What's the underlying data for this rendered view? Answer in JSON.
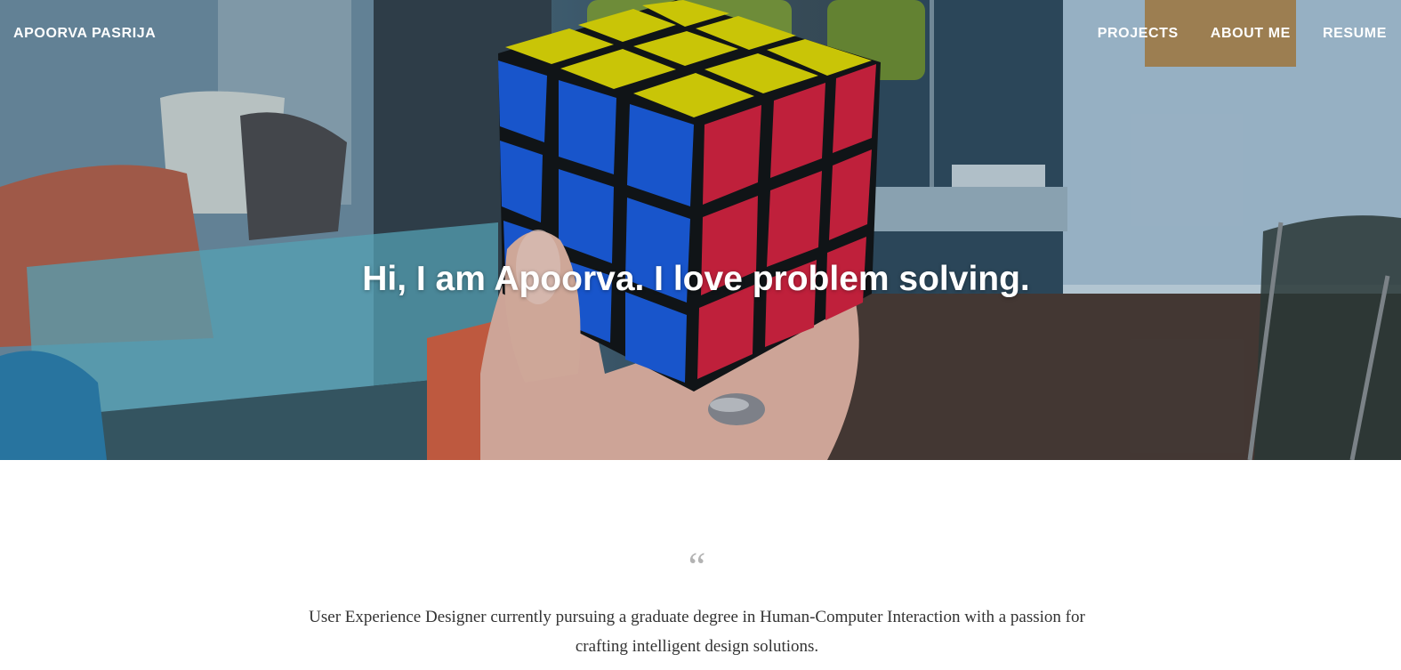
{
  "header": {
    "brand": "APOORVA PASRIJA",
    "nav": [
      "PROJECTS",
      "ABOUT ME",
      "RESUME"
    ]
  },
  "hero": {
    "headline": "Hi, I am Apoorva. I love problem solving.",
    "image": "rubiks-cube-in-hand"
  },
  "intro": {
    "quote_mark": "“",
    "text": "User Experience Designer currently pursuing a graduate degree in Human-Computer Interaction with a passion for crafting intelligent design solutions."
  },
  "colors": {
    "cube_yellow": "#e3db00",
    "cube_blue": "#1a5ce0",
    "cube_red": "#d81f3c",
    "text_white": "#ffffff",
    "bio_text": "#333333",
    "quote_mark": "#b3b3b3"
  }
}
